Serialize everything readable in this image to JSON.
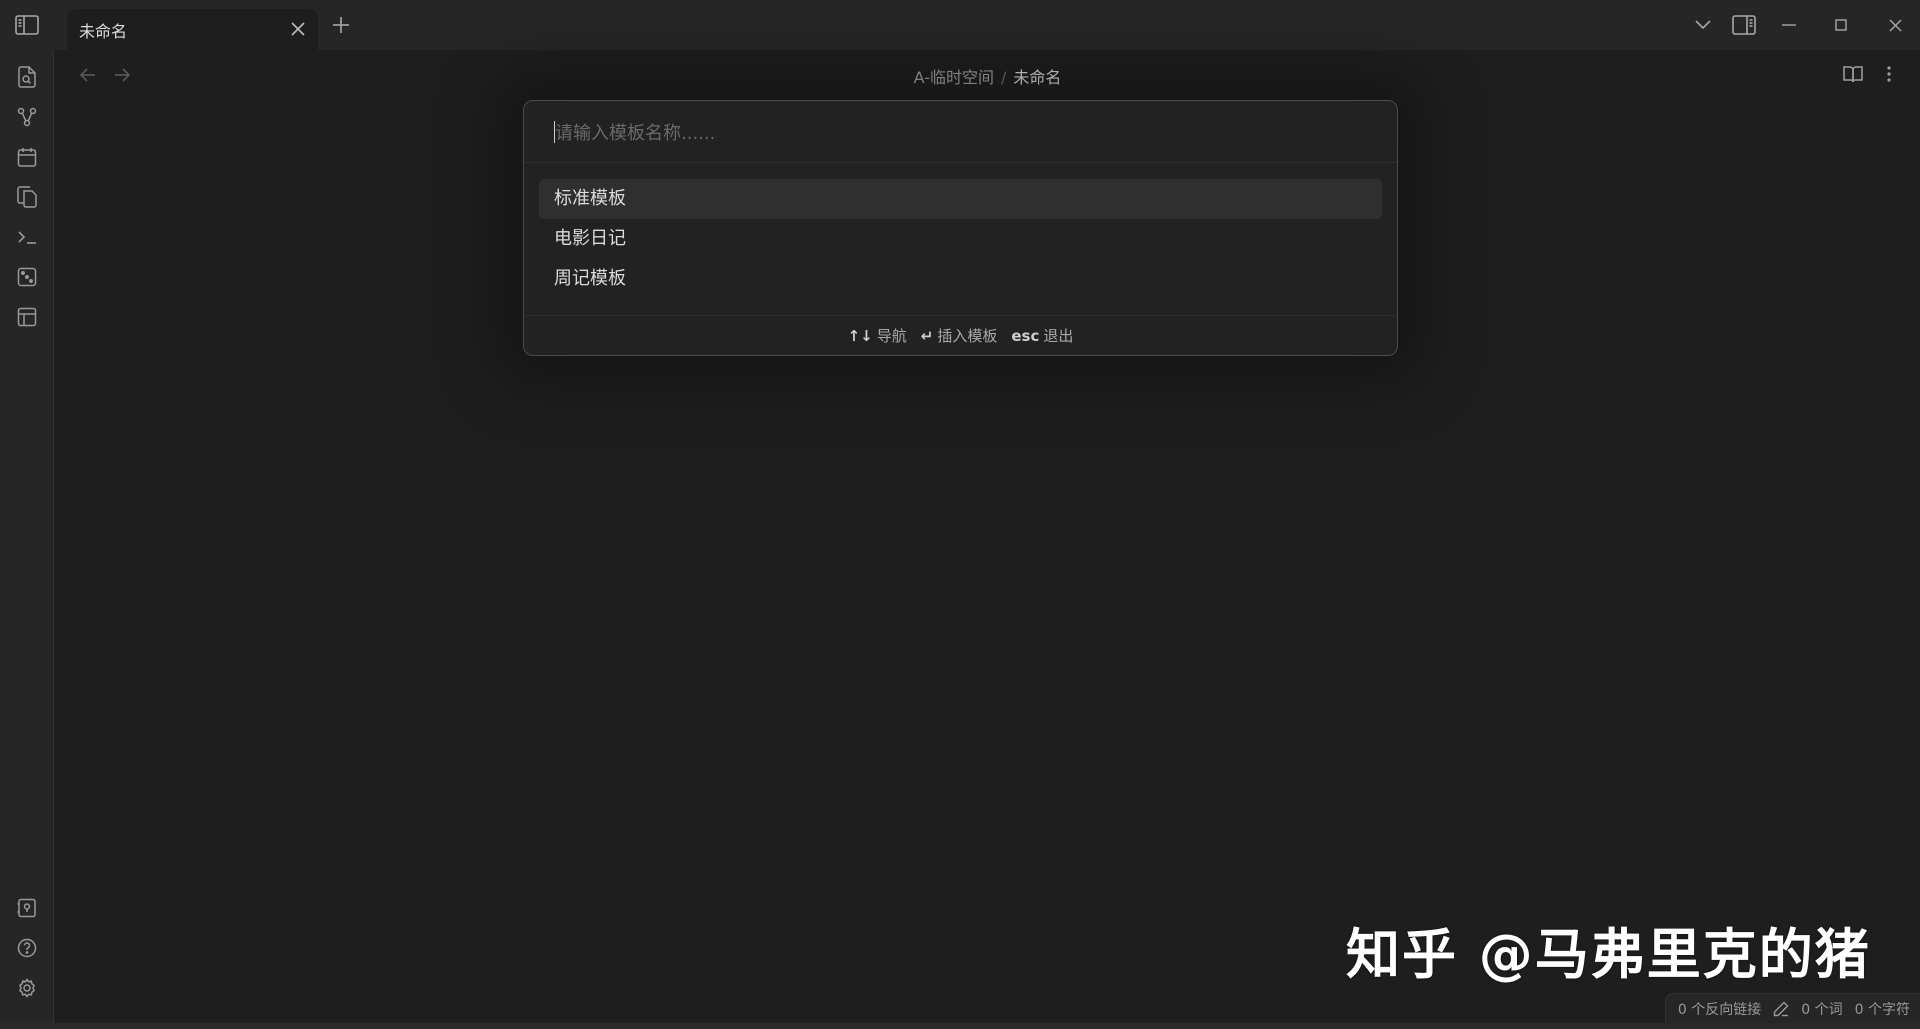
{
  "tab": {
    "title": "未命名"
  },
  "breadcrumb": {
    "folder": "A-临时空间",
    "separator": "/",
    "current": "未命名"
  },
  "modal": {
    "placeholder": "请输入模板名称......",
    "suggestions": [
      {
        "label": "标准模板",
        "selected": true
      },
      {
        "label": "电影日记",
        "selected": false
      },
      {
        "label": "周记模板",
        "selected": false
      }
    ],
    "footer": {
      "navigate_key": "↑↓",
      "navigate_label": "导航",
      "insert_key": "↵",
      "insert_label": "插入模板",
      "exit_key": "esc",
      "exit_label": "退出"
    }
  },
  "status": {
    "backlinks": "0 个反向链接",
    "words": "0 个词",
    "chars": "0 个字符"
  },
  "watermark": "知乎 @马弗里克的猪",
  "colors": {
    "background": "#1e1e1e",
    "chrome": "#262626",
    "selected": "#2f2f2f",
    "text": "#dcdcdc",
    "muted": "#9a9a9a"
  },
  "icons": {
    "ribbon_top": [
      "file-search-icon",
      "graph-icon",
      "calendar-icon",
      "copy-files-icon",
      "terminal-icon",
      "dice-icon",
      "layout-template-icon"
    ],
    "ribbon_bottom": [
      "vault-icon",
      "help-icon",
      "settings-icon"
    ]
  }
}
